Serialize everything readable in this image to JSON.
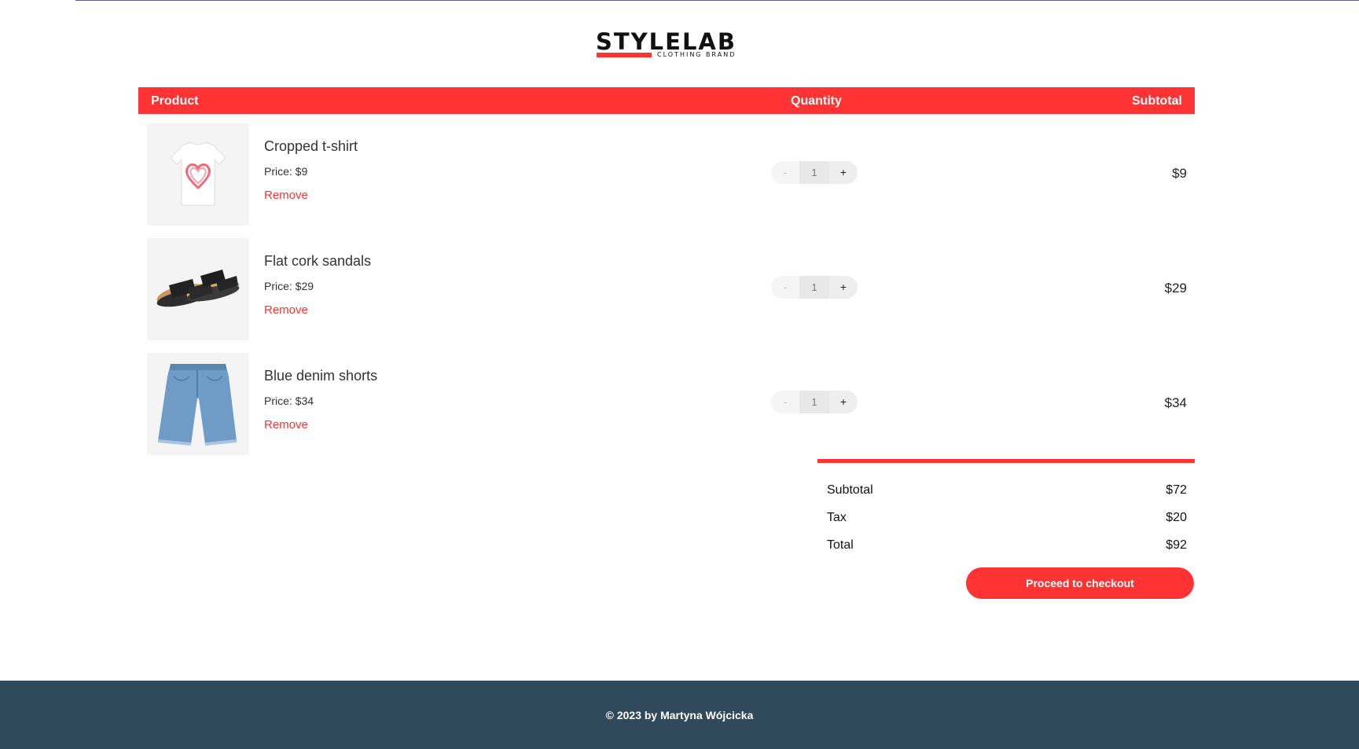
{
  "brand": {
    "name": "STYLELAB",
    "tagline": "CLOTHING  BRAND",
    "accent_color": "#ff3333"
  },
  "cart": {
    "headers": {
      "product": "Product",
      "quantity": "Quantity",
      "subtotal": "Subtotal"
    },
    "items": [
      {
        "name": "Cropped t-shirt",
        "price": "Price: $9",
        "remove_label": "Remove",
        "qty_minus": "-",
        "qty_value": "1",
        "qty_plus": "+",
        "subtotal": "$9",
        "image_icon": "tshirt-icon"
      },
      {
        "name": "Flat cork sandals",
        "price": "Price: $29",
        "remove_label": "Remove",
        "qty_minus": "-",
        "qty_value": "1",
        "qty_plus": "+",
        "subtotal": "$29",
        "image_icon": "sandals-icon"
      },
      {
        "name": "Blue denim shorts",
        "price": "Price: $34",
        "remove_label": "Remove",
        "qty_minus": "-",
        "qty_value": "1",
        "qty_plus": "+",
        "subtotal": "$34",
        "image_icon": "shorts-icon"
      }
    ]
  },
  "summary": {
    "subtotal_label": "Subtotal",
    "subtotal_value": "$72",
    "tax_label": "Tax",
    "tax_value": "$20",
    "total_label": "Total",
    "total_value": "$92",
    "checkout_label": "Proceed to checkout"
  },
  "footer": {
    "text": "© 2023 by Martyna Wójcicka",
    "background_color": "#304a5b"
  }
}
